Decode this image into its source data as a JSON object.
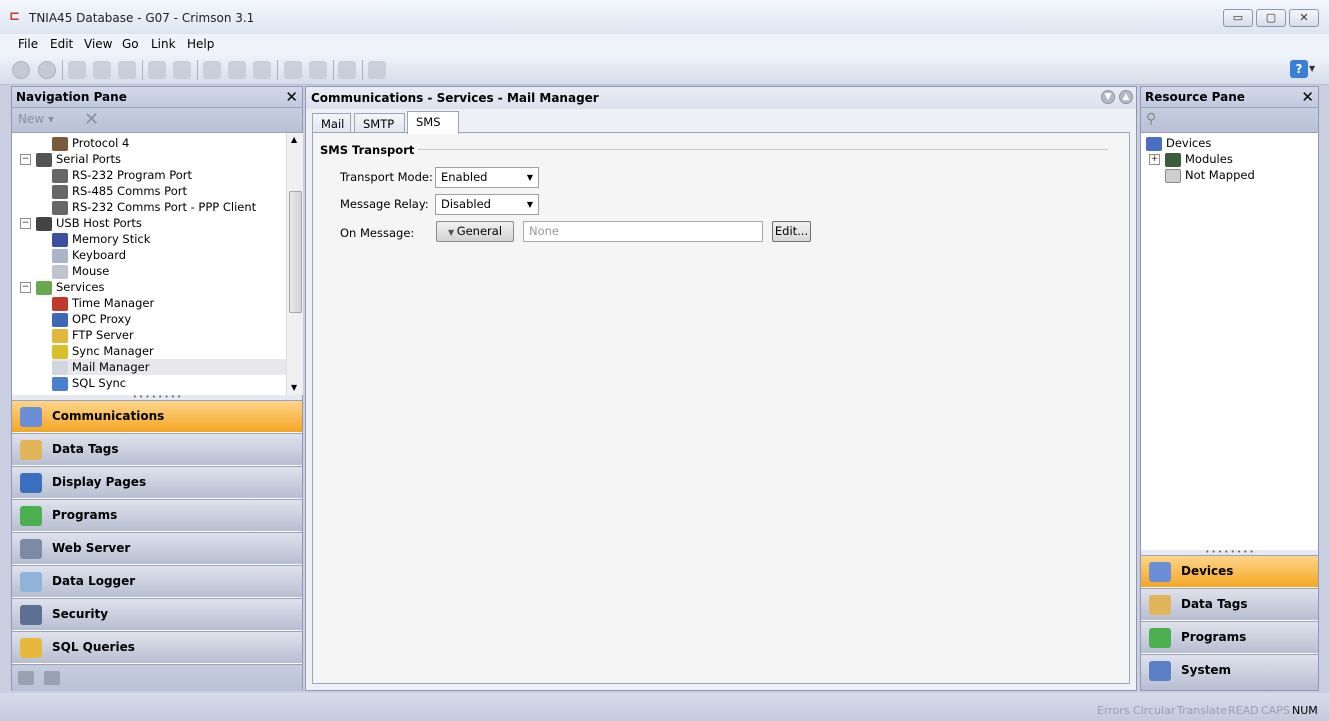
{
  "window": {
    "title": "TNIA45 Database - G07 - Crimson 3.1",
    "minimize_label": "▭",
    "maximize_label": "▢",
    "close_label": "✕"
  },
  "menu": {
    "items": [
      {
        "label": "File"
      },
      {
        "label": "Edit"
      },
      {
        "label": "View"
      },
      {
        "label": "Go"
      },
      {
        "label": "Link"
      },
      {
        "label": "Help"
      }
    ]
  },
  "toolbar": {
    "icons": [
      "back-icon",
      "forward-icon",
      "new-file-icon",
      "open-icon",
      "save-icon",
      "import-icon",
      "export-icon",
      "cut-icon",
      "copy-icon",
      "paste-icon",
      "find-icon",
      "print-icon",
      "link-icon",
      "pen-icon"
    ],
    "help_label": "?"
  },
  "nav_pane": {
    "title": "Navigation Pane",
    "close_label": "✕",
    "new_label": "New ▾",
    "tree": [
      {
        "label": "Protocol 4",
        "level": 2,
        "icon": "protocol-icon"
      },
      {
        "label": "Serial Ports",
        "level": 1,
        "icon": "serial-port-icon",
        "expander": "−"
      },
      {
        "label": "RS-232 Program Port",
        "level": 2,
        "icon": "port-icon"
      },
      {
        "label": "RS-485 Comms Port",
        "level": 2,
        "icon": "port-icon"
      },
      {
        "label": "RS-232 Comms Port - PPP Client",
        "level": 2,
        "icon": "port-icon"
      },
      {
        "label": "USB Host Ports",
        "level": 1,
        "icon": "usb-icon",
        "expander": "−"
      },
      {
        "label": "Memory Stick",
        "level": 2,
        "icon": "memory-stick-icon"
      },
      {
        "label": "Keyboard",
        "level": 2,
        "icon": "keyboard-icon"
      },
      {
        "label": "Mouse",
        "level": 2,
        "icon": "mouse-icon"
      },
      {
        "label": "Services",
        "level": 1,
        "icon": "services-icon",
        "expander": "−"
      },
      {
        "label": "Time Manager",
        "level": 2,
        "icon": "clock-icon"
      },
      {
        "label": "OPC Proxy",
        "level": 2,
        "icon": "opc-icon"
      },
      {
        "label": "FTP Server",
        "level": 2,
        "icon": "ftp-icon"
      },
      {
        "label": "Sync Manager",
        "level": 2,
        "icon": "sync-icon"
      },
      {
        "label": "Mail Manager",
        "level": 2,
        "icon": "mail-icon",
        "selected": true
      },
      {
        "label": "SQL Sync",
        "level": 2,
        "icon": "sql-sync-icon"
      }
    ],
    "categories": [
      {
        "label": "Communications",
        "icon": "communications-icon",
        "active": true
      },
      {
        "label": "Data Tags",
        "icon": "data-tags-icon"
      },
      {
        "label": "Display Pages",
        "icon": "display-pages-icon"
      },
      {
        "label": "Programs",
        "icon": "programs-icon"
      },
      {
        "label": "Web Server",
        "icon": "web-server-icon"
      },
      {
        "label": "Data Logger",
        "icon": "data-logger-icon"
      },
      {
        "label": "Security",
        "icon": "security-icon"
      },
      {
        "label": "SQL Queries",
        "icon": "sql-queries-icon"
      }
    ]
  },
  "main": {
    "breadcrumb": "Communications - Services - Mail Manager",
    "tabs": [
      {
        "label": "Mail"
      },
      {
        "label": "SMTP"
      },
      {
        "label": "SMS",
        "active": true
      }
    ],
    "group_title": "SMS Transport",
    "fields": {
      "transport_mode": {
        "label": "Transport Mode:",
        "value": "Enabled"
      },
      "message_relay": {
        "label": "Message Relay:",
        "value": "Disabled"
      },
      "on_message": {
        "label": "On Message:",
        "button": "General",
        "placeholder": "None",
        "edit": "Edit..."
      }
    }
  },
  "resource_pane": {
    "title": "Resource Pane",
    "close_label": "✕",
    "tree": [
      {
        "label": "Devices",
        "icon": "devices-icon"
      },
      {
        "label": "Modules",
        "icon": "modules-icon",
        "expander": "+"
      },
      {
        "label": "Not Mapped",
        "icon": "not-mapped-icon"
      }
    ],
    "categories": [
      {
        "label": "Devices",
        "icon": "devices-icon",
        "active": true
      },
      {
        "label": "Data Tags",
        "icon": "data-tags-icon"
      },
      {
        "label": "Programs",
        "icon": "programs-icon"
      },
      {
        "label": "System",
        "icon": "system-icon"
      }
    ]
  },
  "status": {
    "items": [
      {
        "label": "Errors",
        "on": false
      },
      {
        "label": "Circular",
        "on": false
      },
      {
        "label": "Translate",
        "on": false
      },
      {
        "label": "READ",
        "on": false
      },
      {
        "label": "CAPS",
        "on": false
      },
      {
        "label": "NUM",
        "on": true
      }
    ]
  },
  "colors": {
    "accent_active": "#f5a623",
    "pane_header": "#c1c9dd"
  }
}
